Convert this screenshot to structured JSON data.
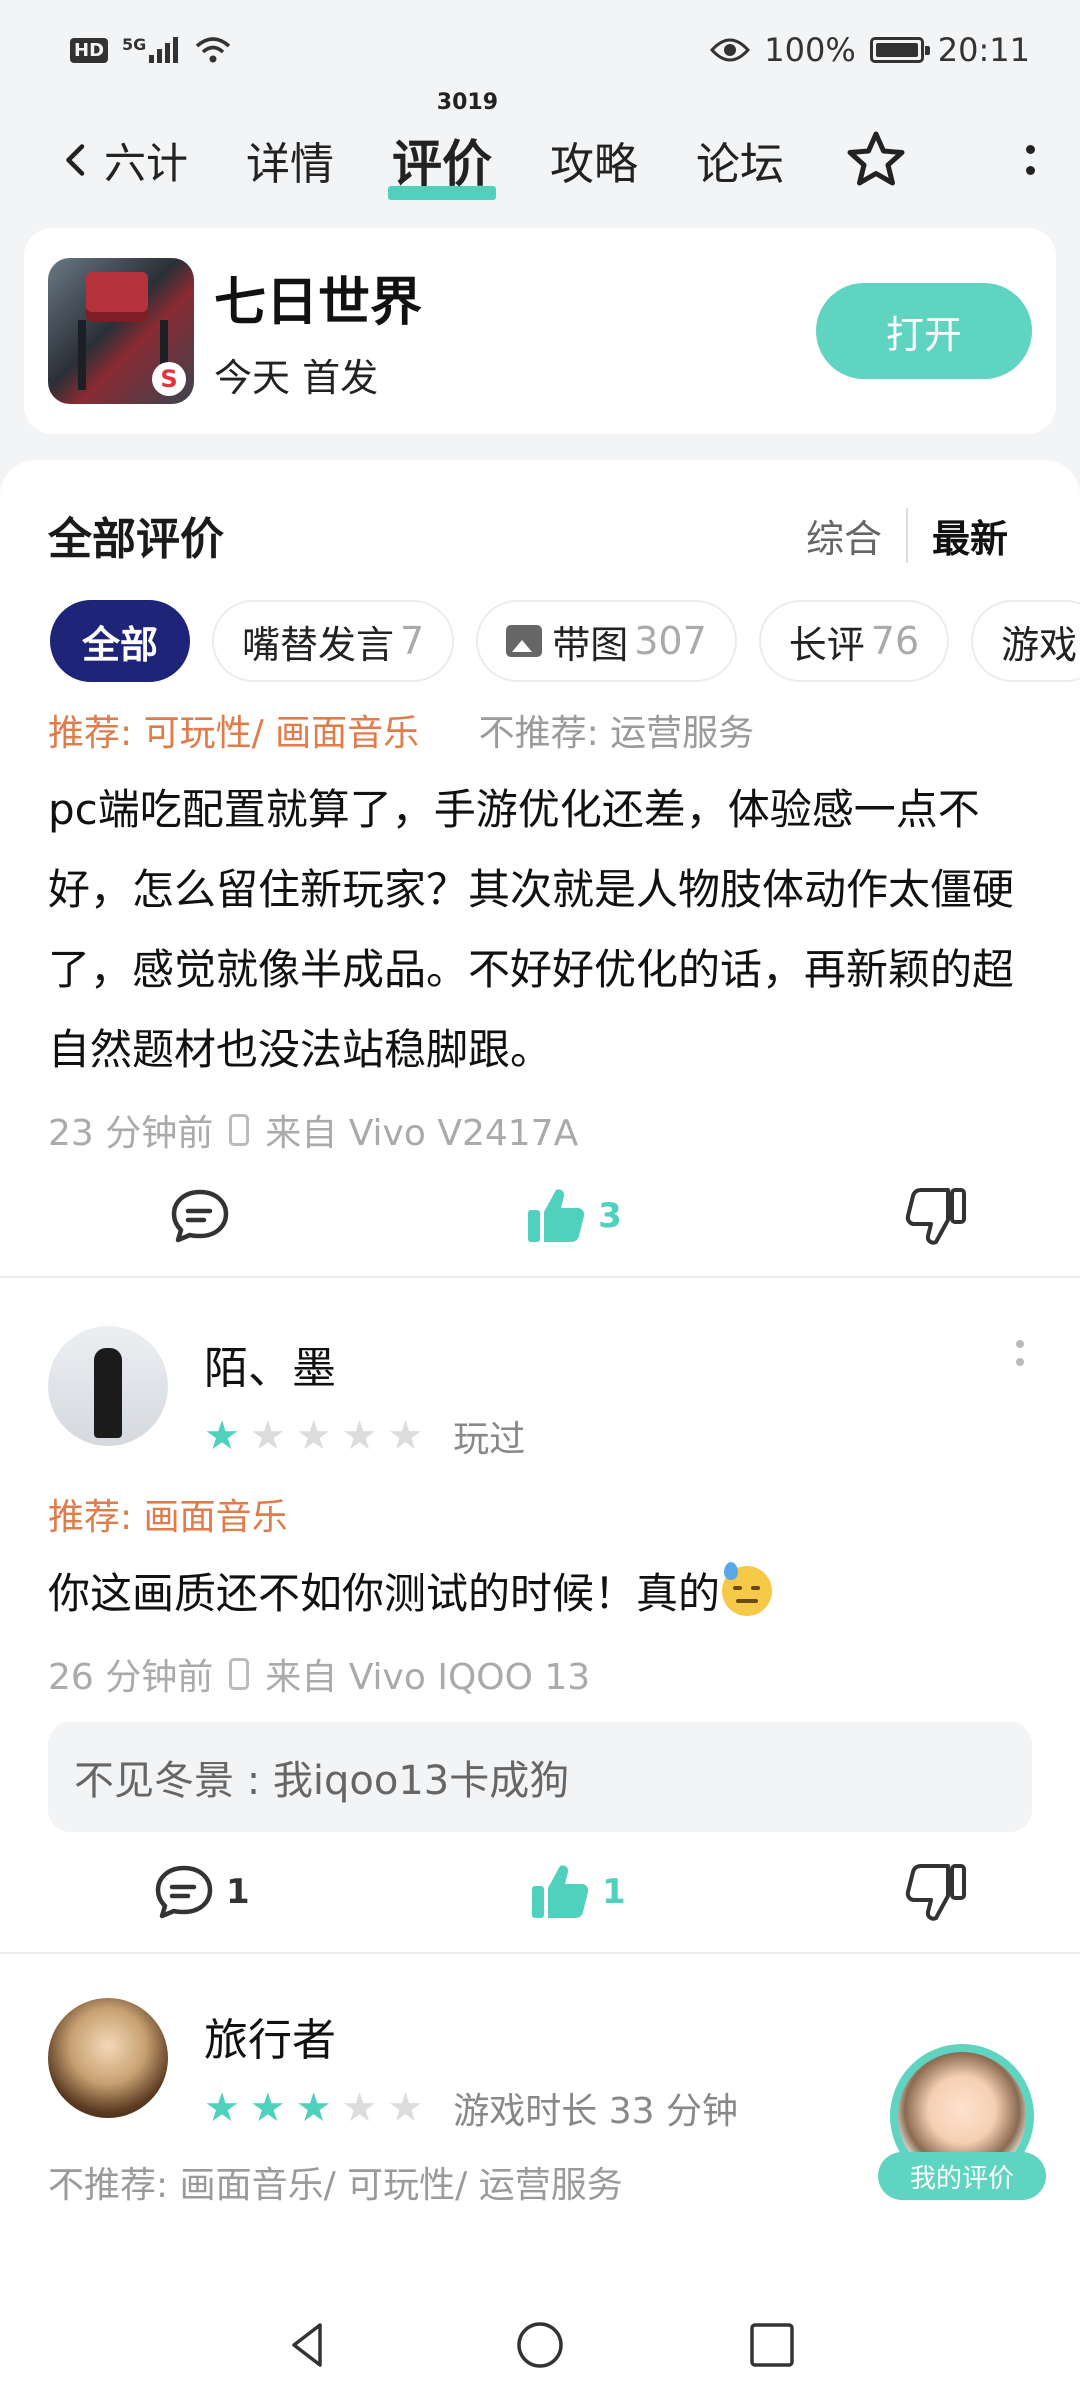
{
  "status_bar": {
    "hd_label": "HD",
    "signal_label": "5G",
    "battery": "100%",
    "battery_level": 1.0,
    "time": "20:11"
  },
  "nav": {
    "back_label": "六计",
    "tabs": [
      {
        "label": "详情"
      },
      {
        "label": "评价",
        "badge": "3019",
        "active": true
      },
      {
        "label": "攻略"
      },
      {
        "label": "论坛"
      }
    ]
  },
  "app": {
    "name": "七日世界",
    "subtitle": "今天 首发",
    "open_label": "打开",
    "accent": "#5fd4c0"
  },
  "reviews_section": {
    "title": "全部评价",
    "sort_options": [
      "综合",
      "最新"
    ],
    "active_sort": "最新",
    "filter_chips": [
      {
        "label": "全部",
        "count": "",
        "active": true
      },
      {
        "label": "嘴替发言",
        "count": "7"
      },
      {
        "label": "带图",
        "count": "307"
      },
      {
        "label": "长评",
        "count": "76"
      },
      {
        "label": "游戏",
        "count": ""
      }
    ]
  },
  "reviews": [
    {
      "recommend": "推荐: 可玩性/ 画面音乐",
      "not_recommend": "不推荐: 运营服务",
      "text": "pc端吃配置就算了，手游优化还差，体验感一点不好，怎么留住新玩家？其次就是人物肢体动作太僵硬了，感觉就像半成品。不好好优化的话，再新颖的超自然题材也没法站稳脚跟。",
      "time": "23 分钟前",
      "device": "来自 Vivo V2417A",
      "comments": "",
      "likes": "3"
    },
    {
      "username": "陌、墨",
      "rating": 1,
      "status": "玩过",
      "recommend": "推荐: 画面音乐",
      "text": "你这画质还不如你测试的时候！真的",
      "time": "26 分钟前",
      "device": "来自 Vivo IQOO 13",
      "reply": "不见冬景 : 我iqoo13卡成狗",
      "comments": "1",
      "likes": "1"
    },
    {
      "username": "旅行者",
      "rating": 3,
      "status": "游戏时长 33 分钟",
      "not_recommend": "不推荐: 画面音乐/ 可玩性/ 运营服务"
    }
  ],
  "fab": {
    "label": "我的评价"
  },
  "colors": {
    "teal": "#4fd1bd",
    "navy": "#1e2477",
    "orange": "#e07b4a"
  }
}
